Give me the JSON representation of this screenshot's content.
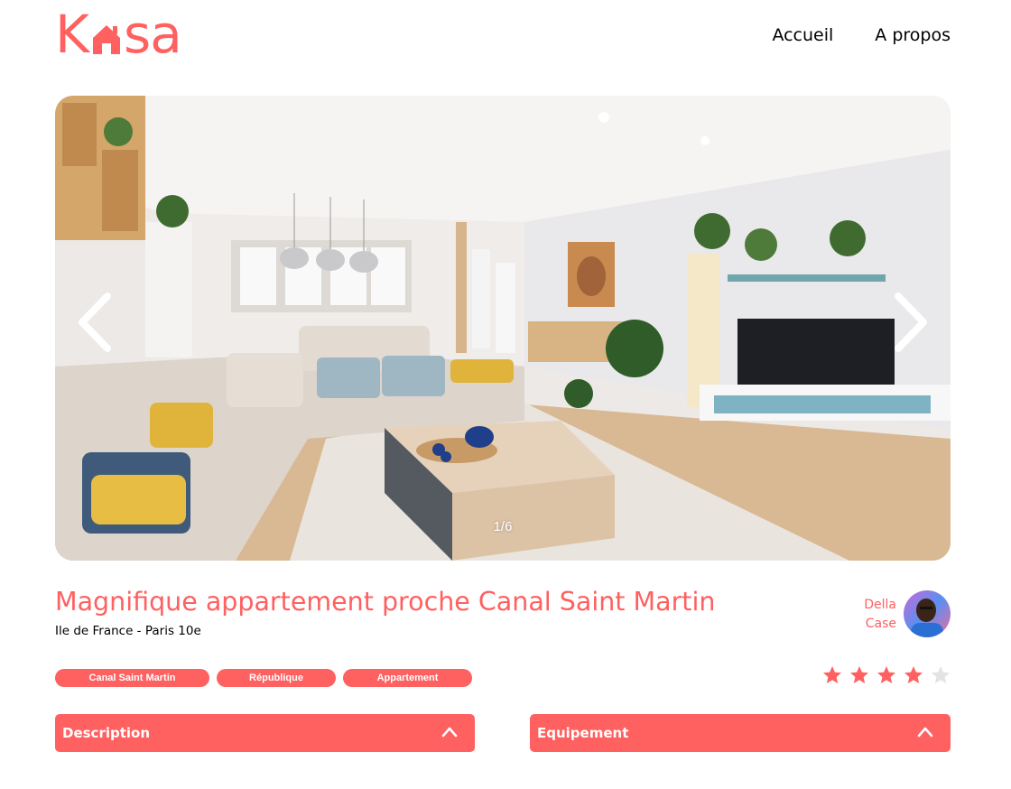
{
  "brand": {
    "logo_text_left": "K",
    "logo_text_right": "sa",
    "color": "#FF6060"
  },
  "nav": {
    "items": [
      {
        "label": "Accueil"
      },
      {
        "label": "A propos"
      }
    ]
  },
  "gallery": {
    "counter": "1/6",
    "current": 1,
    "total": 6
  },
  "listing": {
    "title": "Magnifique appartement proche Canal Saint Martin",
    "location": "Ile de France - Paris 10e",
    "tags": [
      "Canal Saint Martin",
      "République",
      "Appartement"
    ],
    "rating": 4,
    "rating_max": 5
  },
  "host": {
    "first_name": "Della",
    "last_name": "Case"
  },
  "collapses": {
    "description_label": "Description",
    "equipment_label": "Equipement"
  },
  "colors": {
    "accent": "#FF6060",
    "star_empty": "#E3E3E3"
  }
}
